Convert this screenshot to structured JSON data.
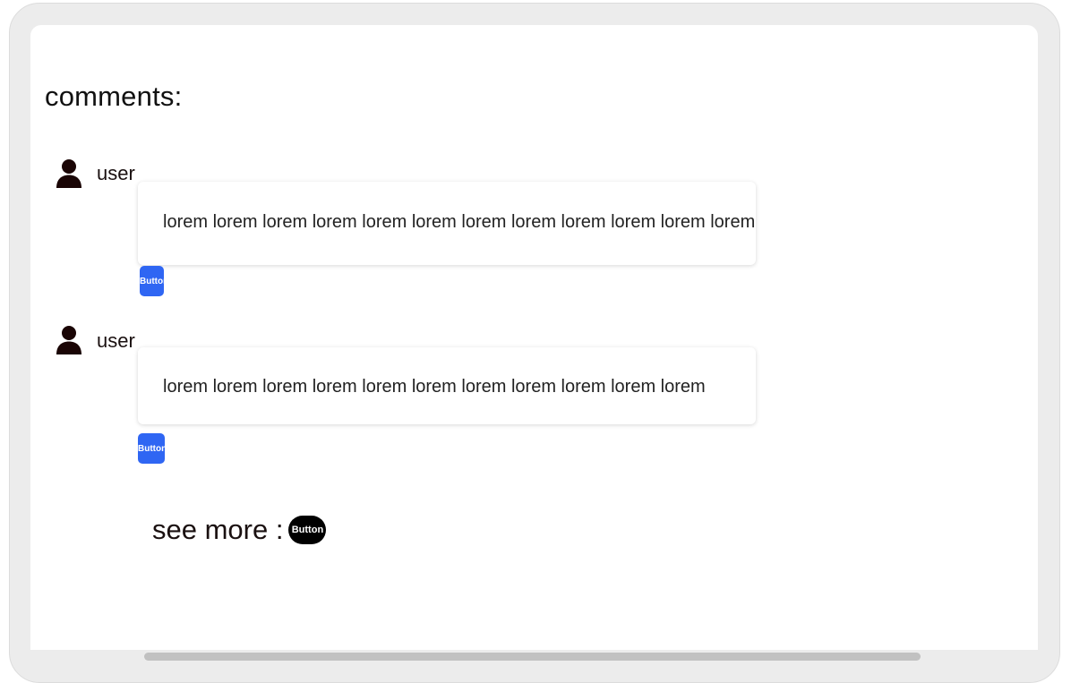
{
  "page": {
    "heading": "comments:"
  },
  "comments": [
    {
      "user": "user",
      "text": "lorem lorem lorem lorem lorem lorem lorem lorem lorem lorem lorem lorem",
      "button_label": "Button"
    },
    {
      "user": "user",
      "text": "lorem lorem lorem lorem lorem lorem lorem lorem lorem lorem lorem",
      "button_label": "Button"
    }
  ],
  "see_more": {
    "label": "see more :",
    "button_label": "Button"
  },
  "icons": {
    "user": "user-icon"
  },
  "colors": {
    "accent_button": "#2f66f3",
    "pill_button": "#000000",
    "user_icon": "#1a0505",
    "frame": "#ececec"
  }
}
